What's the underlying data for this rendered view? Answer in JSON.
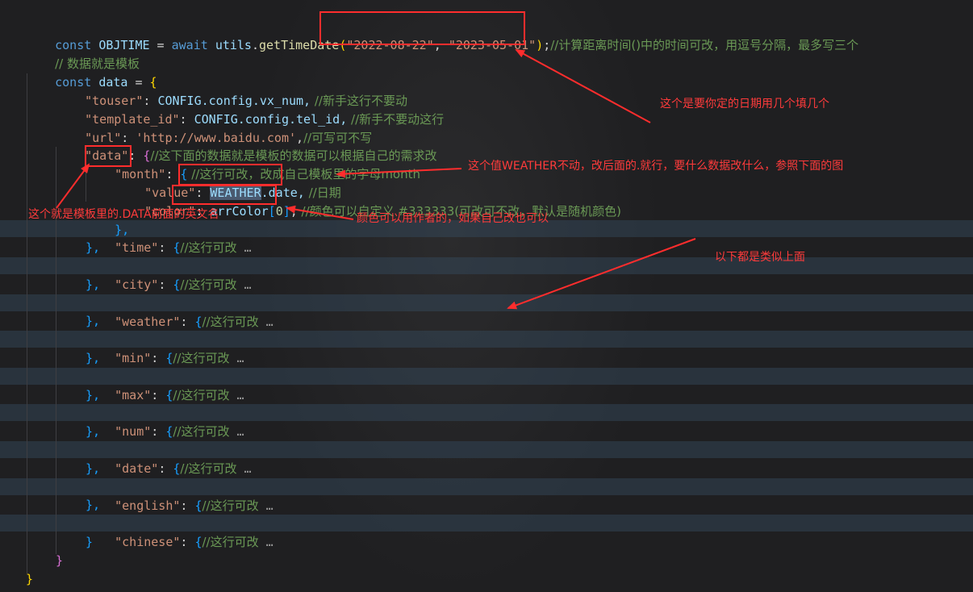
{
  "code": {
    "l1": {
      "kw_const": "const",
      "name": "OBJTIME",
      "eq": " = ",
      "kw_await": "await",
      "obj": "utils",
      "fn": "getTimeDate",
      "open": "(",
      "date1": "\"2022-08-22\"",
      "sep": ", ",
      "date2": "\"2023-05-01\"",
      "close": ")",
      "semi": ";",
      "comment": "//计算距离时间()中的时间可改，用逗号分隔，最多写三个"
    },
    "l2": {
      "comment": "// 数据就是模板"
    },
    "l3": {
      "kw_const": "const",
      "name": "data",
      "eq": " = ",
      "brace": "{"
    },
    "l4": {
      "key": "\"touser\"",
      "colon": ": ",
      "value": "CONFIG.config.vx_num,",
      "comment": " //新手这行不要动"
    },
    "l5": {
      "key": "\"template_id\"",
      "colon": ": ",
      "value": "CONFIG.config.tel_id,",
      "comment": " //新手不要动这行"
    },
    "l6": {
      "key": "\"url\"",
      "colon": ": ",
      "value": "'http://www.baidu.com'",
      "comma": ",",
      "comment": "//可写可不写"
    },
    "l7": {
      "key": "\"data\"",
      "colon": ": ",
      "brace": "{",
      "comment": "//这下面的数据就是模板的数据可以根据自己的需求改"
    },
    "l8": {
      "key": "\"month\"",
      "colon": ": ",
      "brace": "{",
      "comment": " //这行可改，改成自己模板里的字母month"
    },
    "l9": {
      "key": "\"value\"",
      "colon": ": ",
      "obj": "WEATHER",
      "prop": ".date,",
      "comment": " //日期"
    },
    "l10": {
      "key": "\"color\"",
      "colon": ": ",
      "obj": "arrColor",
      "idx_open": "[",
      "idx": "0",
      "idx_close": "]",
      "comma": ",",
      "comment": " //颜色可以自定义 #333333(可改可不改，默认是随机颜色)"
    },
    "folded": [
      {
        "key": "\"time\"",
        "colon": ": ",
        "brace": "{",
        "comment": "//这行可改",
        "dots": " …"
      },
      {
        "key": "\"city\"",
        "colon": ": ",
        "brace": "{",
        "comment": "//这行可改",
        "dots": " …"
      },
      {
        "key": "\"weather\"",
        "colon": ": ",
        "brace": "{",
        "comment": "//这行可改",
        "dots": " …"
      },
      {
        "key": "\"min\"",
        "colon": ": ",
        "brace": "{",
        "comment": "//这行可改",
        "dots": " …"
      },
      {
        "key": "\"max\"",
        "colon": ": ",
        "brace": "{",
        "comment": "//这行可改",
        "dots": " …"
      },
      {
        "key": "\"num\"",
        "colon": ": ",
        "brace": "{",
        "comment": "//这行可改",
        "dots": " …"
      },
      {
        "key": "\"date\"",
        "colon": ": ",
        "brace": "{",
        "comment": "//这行可改",
        "dots": " …"
      },
      {
        "key": "\"english\"",
        "colon": ": ",
        "brace": "{",
        "comment": "//这行可改",
        "dots": " …"
      },
      {
        "key": "\"chinese\"",
        "colon": ": ",
        "brace": "{",
        "comment": "//这行可改",
        "dots": " …"
      }
    ],
    "close_inner_comma": "},",
    "close_inner_last": "}",
    "close_data": "}",
    "close_root": "}"
  },
  "annotations": {
    "dates": "这个是要你定的日期用几个填几个",
    "weather": "这个值WEATHER不动，改后面的.就行，要什么数据改什么，参照下面的图",
    "month": "这个就是模板里的.DATA前面的英文名",
    "color": "颜色可以用作者的，如果自己改也可以",
    "similar": "以下都是类似上面"
  },
  "colors": {
    "annotation": "#ff2d2d",
    "background": "#1f1f21",
    "fold_band": "#384e64"
  }
}
